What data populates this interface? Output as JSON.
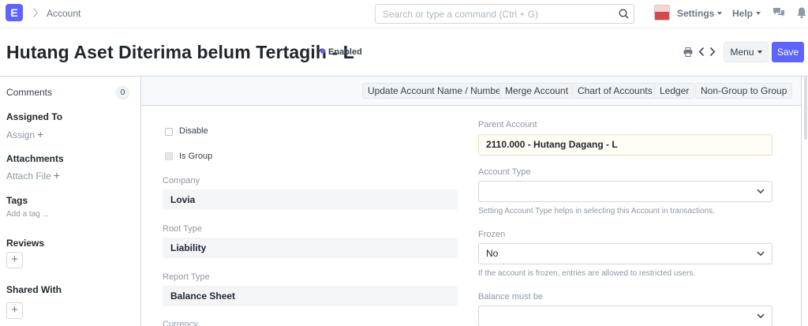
{
  "navbar": {
    "logo": "E",
    "breadcrumb": "Account",
    "search_placeholder": "Search or type a command (Ctrl + G)",
    "settings_label": "Settings",
    "help_label": "Help"
  },
  "page": {
    "title": "Hutang Aset Diterima belum Tertagih - L",
    "status": "Enabled",
    "menu_label": "Menu",
    "save_label": "Save",
    "accent_color": "#5e64ff"
  },
  "sidebar": {
    "comments_label": "Comments",
    "comments_count": "0",
    "assigned_to_label": "Assigned To",
    "assign_label": "Assign",
    "attachments_label": "Attachments",
    "attach_file_label": "Attach File",
    "tags_label": "Tags",
    "add_tag_label": "Add a tag ...",
    "reviews_label": "Reviews",
    "shared_with_label": "Shared With"
  },
  "toolbar": {
    "buttons": [
      "Update Account Name / Number",
      "Merge Account",
      "Chart of Accounts",
      "Ledger",
      "Non-Group to Group"
    ]
  },
  "form": {
    "disable_label": "Disable",
    "is_group_label": "Is Group",
    "company_label": "Company",
    "company_value": "Lovia",
    "root_type_label": "Root Type",
    "root_type_value": "Liability",
    "report_type_label": "Report Type",
    "report_type_value": "Balance Sheet",
    "currency_label": "Currency",
    "parent_account_label": "Parent Account",
    "parent_account_value": "2110.000 - Hutang Dagang - L",
    "account_type_label": "Account Type",
    "account_type_value": "",
    "account_type_help": "Setting Account Type helps in selecting this Account in transactions.",
    "frozen_label": "Frozen",
    "frozen_value": "No",
    "frozen_help": "If the account is frozen, entries are allowed to restricted users.",
    "balance_label": "Balance must be",
    "balance_value": ""
  }
}
